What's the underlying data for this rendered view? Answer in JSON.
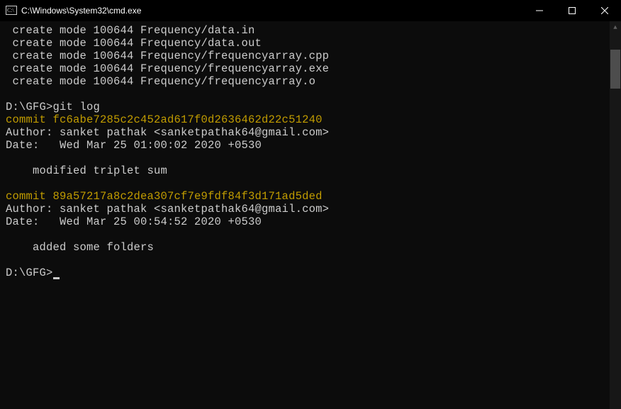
{
  "titlebar": {
    "title": "C:\\Windows\\System32\\cmd.exe"
  },
  "terminal": {
    "create_lines": [
      " create mode 100644 Frequency/data.in",
      " create mode 100644 Frequency/data.out",
      " create mode 100644 Frequency/frequencyarray.cpp",
      " create mode 100644 Frequency/frequencyarray.exe",
      " create mode 100644 Frequency/frequencyarray.o"
    ],
    "prompt1_path": "D:\\GFG>",
    "prompt1_cmd": "git log",
    "commits": [
      {
        "commit_line": "commit fc6abe7285c2c452ad617f0d2636462d22c51240",
        "author_line": "Author: sanket pathak <sanketpathak64@gmail.com>",
        "date_line": "Date:   Wed Mar 25 01:00:02 2020 +0530",
        "message": "    modified triplet sum"
      },
      {
        "commit_line": "commit 89a57217a8c2dea307cf7e9fdf84f3d171ad5ded",
        "author_line": "Author: sanket pathak <sanketpathak64@gmail.com>",
        "date_line": "Date:   Wed Mar 25 00:54:52 2020 +0530",
        "message": "    added some folders"
      }
    ],
    "prompt2_path": "D:\\GFG>"
  }
}
